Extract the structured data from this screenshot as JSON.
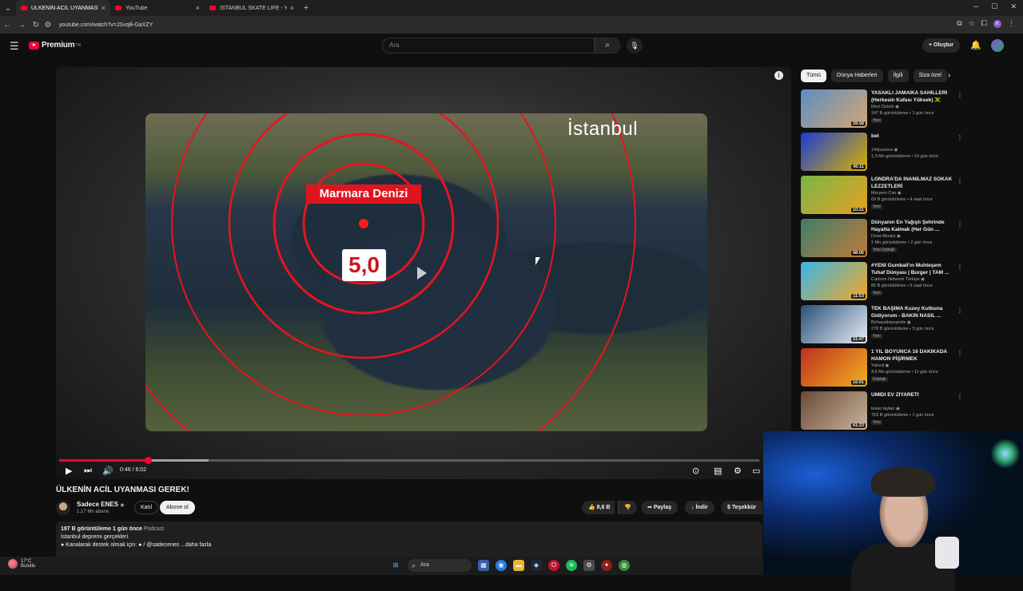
{
  "browser": {
    "tabs": [
      {
        "title": "ÜLKENİN ACİL UYANMASI GERE",
        "active": true
      },
      {
        "title": "YouTube",
        "active": false
      },
      {
        "title": "İSTANBUL SKATE LIFE - YouTube",
        "active": false
      }
    ],
    "url": "youtube.com/watch?v=JSvqB-GaXZY"
  },
  "header": {
    "logo_text": "Premium",
    "logo_sup": "TR",
    "search_placeholder": "Ara",
    "create_label": "Oluştur",
    "profile_initial": "K"
  },
  "video": {
    "city_label": "İstanbul",
    "sea_label": "Marmara Denizi",
    "magnitude": "5,0",
    "time": "0:46 / 6:02",
    "progress_fraction": 0.127,
    "buffered_fraction": 0.214
  },
  "below": {
    "title": "ÜLKENİN ACİL UYANMASI GEREK!",
    "channel": "Sadece ENES",
    "verified": "◉",
    "subs": "1,17 Mn abone",
    "join": "Katıl",
    "subscribe": "Abone ol",
    "likes": "8,6 B",
    "share": "Paylaş",
    "download": "İndir",
    "thanks": "Teşekkür",
    "desc_meta": "197 B görüntüleme  1 gün önce",
    "desc_tag": "Podcast",
    "desc_line1": "İstanbul depremi gerçekleri.",
    "desc_line2": "● Kanalarak destek olmak için: ● / @sadecenes    ...daha fazla"
  },
  "chips": [
    "Tümü",
    "Dünya Haberleri",
    "İlgili",
    "Siza özel"
  ],
  "recommendations": [
    {
      "title": "YASAKLI JAMAİKA SAHİLLERİ (Herkesin Kafası Yüksek) 🇯🇲",
      "channel": "Mert Öztürk ◉",
      "meta": "247 B görüntüleme • 1 gün önce",
      "badge": "Yeni",
      "duration": "39:58",
      "color1": "#5b8fc4",
      "color2": "#d4a574"
    },
    {
      "title": "bet",
      "channel": "140journos ◉",
      "meta": "1,3 Mn görüntüleme • 10 gün önce",
      "badge": "",
      "duration": "45:11",
      "color1": "#1a3bd6",
      "color2": "#d8b300"
    },
    {
      "title": "LONDRA'DA İNANILMAZ SOKAK LEZZETLERİ",
      "channel": "Meryem Can ◉",
      "meta": "69 B görüntüleme • 4 saat önce",
      "badge": "Yeni",
      "duration": "10:21",
      "color1": "#7ab648",
      "color2": "#e8a020"
    },
    {
      "title": "Dünyanın En Yağışlı Şehrinde Hayatta Kalmak (Her Gün ...",
      "channel": "Drew Binsky ◉",
      "meta": "2 Mn görüntüleme • 2 gün önce",
      "badge": "Yeni   Dublajlı",
      "duration": "48:06",
      "color1": "#3d7f6a",
      "color2": "#c07a3a"
    },
    {
      "title": "#YENİ Gumball'ın Muhteşem Tuhaf Dünyası | Burger | TAM ...",
      "channel": "Cartoon Network Türkiye ◉",
      "meta": "85 B görüntüleme • 5 saat önce",
      "badge": "Yeni",
      "duration": "11:53",
      "color1": "#38b6e8",
      "color2": "#f5a623"
    },
    {
      "title": "TEK BAŞIMA Kuzey Kutbuna Gidiyorum - BAKIN NASIL ...",
      "channel": "Birhayalinpeşinde ◉",
      "meta": "278 B görüntüleme • 5 gün önce",
      "badge": "Yeni",
      "duration": "31:47",
      "color1": "#2a4f7a",
      "color2": "#e8eef5"
    },
    {
      "title": "1 YIL BOYUNCA 16 DAKİKADA HAMON PİŞİRMEK",
      "channel": "Yakzal ◉",
      "meta": "4,5 Mn görüntüleme • 11 gün önce",
      "badge": "Dublajlı",
      "duration": "16:01",
      "color1": "#c03020",
      "color2": "#f0b020"
    },
    {
      "title": "ÜMİDİ EV ZİYARETİ",
      "channel": "tesko tayları ◉",
      "meta": "763 B görüntüleme • 1 gün önce",
      "badge": "Yeni",
      "duration": "41:23",
      "color1": "#6a4a3a",
      "color2": "#c9b49a"
    }
  ],
  "taskbar": {
    "temp": "17°C",
    "weather": "Bulutlu",
    "search": "Ara"
  }
}
